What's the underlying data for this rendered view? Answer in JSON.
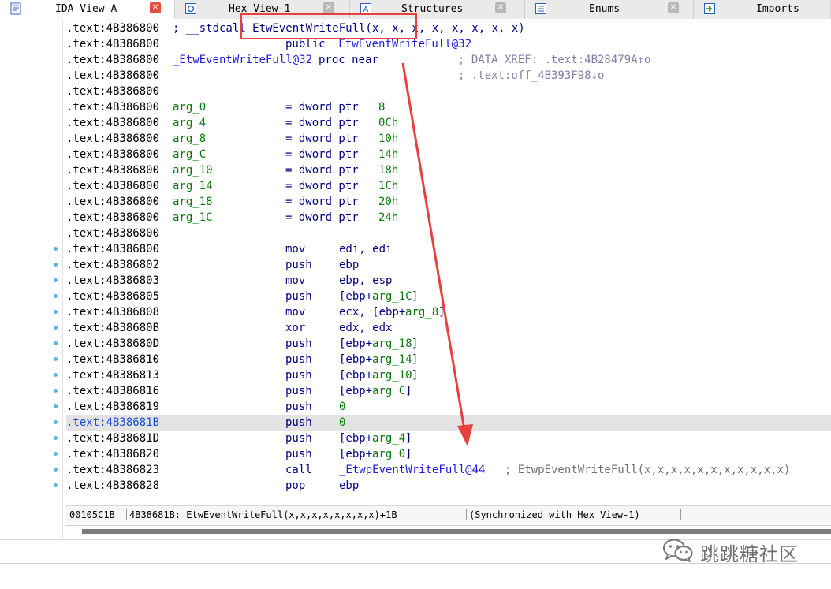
{
  "tabs": [
    {
      "label": "IDA View-A",
      "active": true,
      "icon": "ida-view-icon",
      "close_style": "red"
    },
    {
      "label": "Hex View-1",
      "active": false,
      "icon": "hex-view-icon",
      "close_style": "gray"
    },
    {
      "label": "Structures",
      "active": false,
      "icon": "structures-icon",
      "close_style": "gray"
    },
    {
      "label": "Enums",
      "active": false,
      "icon": "enums-icon",
      "close_style": "gray"
    },
    {
      "label": "Imports",
      "active": false,
      "icon": "imports-icon",
      "close_style": "none"
    }
  ],
  "lines": [
    {
      "addr": ".text:4B386800",
      "label": "",
      "cmt_a": "; __stdcall EtwEventWriteFull(x, x, x, x, x, x, x, x)"
    },
    {
      "addr": ".text:4B386800",
      "label": "",
      "op": "public",
      "arg": "_EtwEventWriteFull@32"
    },
    {
      "addr": ".text:4B386800",
      "label": "_EtwEventWriteFull@32",
      "op": "proc near",
      "cmt": "; DATA XREF: .text:4B28479A↑o"
    },
    {
      "addr": ".text:4B386800",
      "cmt": "; .text:off_4B393F98↓o"
    },
    {
      "addr": ".text:4B386800"
    },
    {
      "addr": ".text:4B386800",
      "var": "arg_0",
      "eq": "= dword ptr",
      "val": "8"
    },
    {
      "addr": ".text:4B386800",
      "var": "arg_4",
      "eq": "= dword ptr",
      "val": "0Ch"
    },
    {
      "addr": ".text:4B386800",
      "var": "arg_8",
      "eq": "= dword ptr",
      "val": "10h"
    },
    {
      "addr": ".text:4B386800",
      "var": "arg_C",
      "eq": "= dword ptr",
      "val": "14h"
    },
    {
      "addr": ".text:4B386800",
      "var": "arg_10",
      "eq": "= dword ptr",
      "val": "18h"
    },
    {
      "addr": ".text:4B386800",
      "var": "arg_14",
      "eq": "= dword ptr",
      "val": "1Ch"
    },
    {
      "addr": ".text:4B386800",
      "var": "arg_18",
      "eq": "= dword ptr",
      "val": "20h"
    },
    {
      "addr": ".text:4B386800",
      "var": "arg_1C",
      "eq": "= dword ptr",
      "val": "24h"
    },
    {
      "addr": ".text:4B386800"
    },
    {
      "addr": ".text:4B386800",
      "mn": "mov",
      "ops": [
        [
          "edi, edi",
          "black"
        ]
      ],
      "dot": true
    },
    {
      "addr": ".text:4B386802",
      "mn": "push",
      "ops": [
        [
          "ebp",
          "black"
        ]
      ],
      "dot": true
    },
    {
      "addr": ".text:4B386803",
      "mn": "mov",
      "ops": [
        [
          "ebp, esp",
          "black"
        ]
      ],
      "dot": true
    },
    {
      "addr": ".text:4B386805",
      "mn": "push",
      "ops": [
        [
          "[ebp+",
          "black"
        ],
        [
          "arg_1C",
          "green"
        ],
        [
          "]",
          "black"
        ]
      ],
      "dot": true
    },
    {
      "addr": ".text:4B386808",
      "mn": "mov",
      "ops": [
        [
          "ecx, [ebp+",
          "black"
        ],
        [
          "arg_8",
          "green"
        ],
        [
          "]",
          "black"
        ]
      ],
      "dot": true
    },
    {
      "addr": ".text:4B38680B",
      "mn": "xor",
      "ops": [
        [
          "edx, edx",
          "black"
        ]
      ],
      "dot": true
    },
    {
      "addr": ".text:4B38680D",
      "mn": "push",
      "ops": [
        [
          "[ebp+",
          "black"
        ],
        [
          "arg_18",
          "green"
        ],
        [
          "]",
          "black"
        ]
      ],
      "dot": true
    },
    {
      "addr": ".text:4B386810",
      "mn": "push",
      "ops": [
        [
          "[ebp+",
          "black"
        ],
        [
          "arg_14",
          "green"
        ],
        [
          "]",
          "black"
        ]
      ],
      "dot": true
    },
    {
      "addr": ".text:4B386813",
      "mn": "push",
      "ops": [
        [
          "[ebp+",
          "black"
        ],
        [
          "arg_10",
          "green"
        ],
        [
          "]",
          "black"
        ]
      ],
      "dot": true
    },
    {
      "addr": ".text:4B386816",
      "mn": "push",
      "ops": [
        [
          "[ebp+",
          "black"
        ],
        [
          "arg_C",
          "green"
        ],
        [
          "]",
          "black"
        ]
      ],
      "dot": true
    },
    {
      "addr": ".text:4B386819",
      "mn": "push",
      "ops": [
        [
          "0",
          "green"
        ]
      ],
      "dot": true
    },
    {
      "addr": ".text:4B38681B",
      "mn": "push",
      "ops": [
        [
          "0",
          "green"
        ]
      ],
      "dot": true,
      "hl": true
    },
    {
      "addr": ".text:4B38681D",
      "mn": "push",
      "ops": [
        [
          "[ebp+",
          "black"
        ],
        [
          "arg_4",
          "green"
        ],
        [
          "]",
          "black"
        ]
      ],
      "dot": true
    },
    {
      "addr": ".text:4B386820",
      "mn": "push",
      "ops": [
        [
          "[ebp+",
          "black"
        ],
        [
          "arg_0",
          "green"
        ],
        [
          "]",
          "black"
        ]
      ],
      "dot": true
    },
    {
      "addr": ".text:4B386823",
      "mn": "call",
      "ops": [
        [
          "_EtwpEventWriteFull@44",
          "blue"
        ]
      ],
      "cmt2": "; EtwpEventWriteFull(x,x,x,x,x,x,x,x,x,x,x)",
      "dot": true
    },
    {
      "addr": ".text:4B386828",
      "mn": "pop",
      "ops": [
        [
          "ebp",
          "black"
        ]
      ],
      "dot": true
    }
  ],
  "status": {
    "offset": "00105C1B",
    "location": "4B38681B: EtwEventWriteFull(x,x,x,x,x,x,x,x)+1B",
    "sync": "(Synchronized with Hex View-1)"
  },
  "watermark": {
    "text": "跳跳糖社区",
    "icon": "wechat-icon"
  },
  "colors": {
    "address": "#000000",
    "highlight_address": "#1a4fd1",
    "name_blue": "#1d1ddb",
    "arg_green": "#0b7a0b",
    "xref_comment": "#7f7fa8",
    "annotation_red": "#e8403d",
    "gutter_dot": "#55b6e3"
  }
}
